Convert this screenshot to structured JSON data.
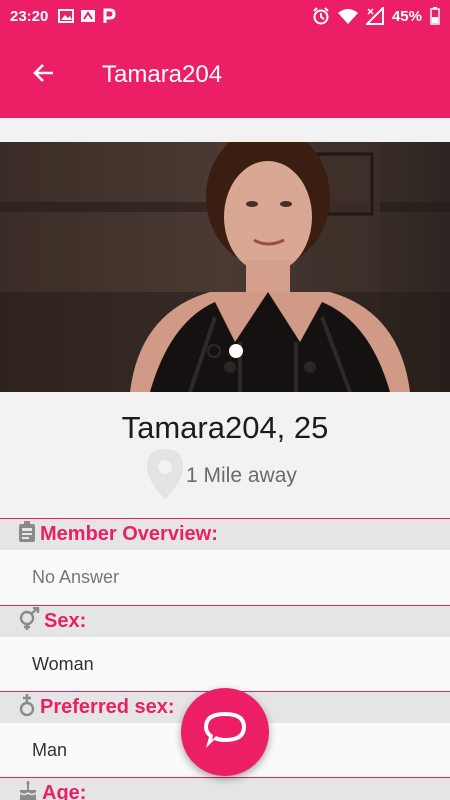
{
  "status_bar": {
    "time": "23:20",
    "battery": "45%",
    "left_icons": [
      "image-icon",
      "sim-icon",
      "parking-icon"
    ],
    "right_icons": [
      "alarm-icon",
      "wifi-icon",
      "signal-icon",
      "battery-icon"
    ]
  },
  "app_bar": {
    "title": "Tamara204",
    "back_icon": "arrow-back-icon"
  },
  "photo": {
    "slide_count": 2,
    "active_slide": 2
  },
  "profile": {
    "name_age": "Tamara204, 25",
    "distance": "1 Mile away",
    "distance_icon": "location-pin-icon"
  },
  "sections": {
    "overview_label": "Member Overview:",
    "overview_value": "No Answer",
    "overview_icon": "id-badge-icon",
    "sex_label": "Sex:",
    "sex_value": "Woman",
    "sex_icon": "gender-icon",
    "preferred_label": "Preferred sex:",
    "preferred_value": "Man",
    "preferred_icon": "preferred-sex-icon",
    "age_label": "Age:",
    "age_icon": "cake-icon"
  },
  "fab": {
    "icon": "chat-bubble-icon"
  },
  "colors": {
    "accent": "#ec1f66",
    "header_bg": "#e5e5e5",
    "value_bg": "#fafafa",
    "value_muted": "#777777",
    "value_text": "#333333"
  }
}
